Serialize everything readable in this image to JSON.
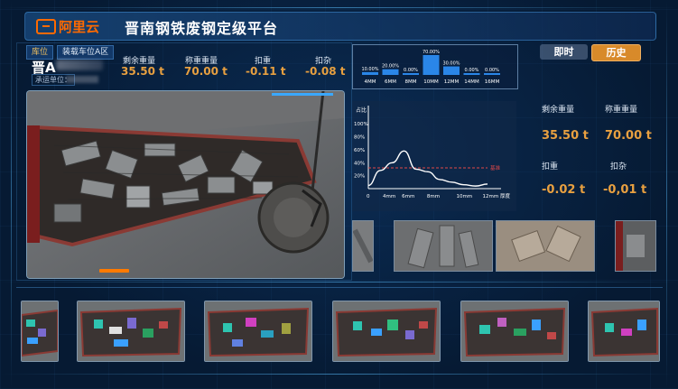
{
  "header": {
    "logo_text": "阿里云",
    "title": "晋南钢铁废钢定级平台"
  },
  "vehicle": {
    "tag_position": "库位",
    "tag_area": "装载车位A区",
    "plate": "晋A",
    "unit_label": "承运单位："
  },
  "metrics": [
    {
      "label": "剩余重量",
      "value": "35.50 t"
    },
    {
      "label": "称重重量",
      "value": "70.00 t"
    },
    {
      "label": "扣重",
      "value": "-0.11 t"
    },
    {
      "label": "扣杂",
      "value": "-0.08 t"
    }
  ],
  "tabs": {
    "realtime": "即时",
    "history": "历史"
  },
  "distribution": {
    "categories": [
      "4MM",
      "6MM",
      "8MM",
      "10MM",
      "12MM",
      "14MM",
      "16MM"
    ],
    "values": [
      10.0,
      20.0,
      0.0,
      70.0,
      30.0,
      0.0,
      0.0
    ],
    "labels": [
      "10.00%",
      "20.00%",
      "0.00%",
      "70.00%",
      "30.00%",
      "0.00%",
      "0.00%"
    ],
    "color": "#2a86e8"
  },
  "chart_data": {
    "type": "line",
    "title": "",
    "ylabel": "占比",
    "xlabel": "厚度",
    "x_ticks": [
      "4mm",
      "6mm",
      "8mm",
      "10mm",
      "12mm"
    ],
    "y_ticks": [
      "100%",
      "80%",
      "60%",
      "40%",
      "20%"
    ],
    "ylim": [
      0,
      110
    ],
    "series": [
      {
        "x": [
          0,
          1,
          2,
          3,
          4,
          5,
          6,
          7,
          8,
          9,
          10
        ],
        "values": [
          5,
          28,
          40,
          58,
          30,
          26,
          14,
          10,
          6,
          4,
          7
        ]
      }
    ],
    "threshold": {
      "value": 32,
      "label": "基准",
      "color": "#e04848"
    },
    "line_color": "#ffffff"
  },
  "right_metrics": [
    {
      "label": "剩余重量",
      "value": "35.50 t"
    },
    {
      "label": "称重重量",
      "value": "70.00 t"
    },
    {
      "label": "扣重",
      "value": "-0.02 t"
    },
    {
      "label": "扣杂",
      "value": "-0,01 t"
    }
  ]
}
